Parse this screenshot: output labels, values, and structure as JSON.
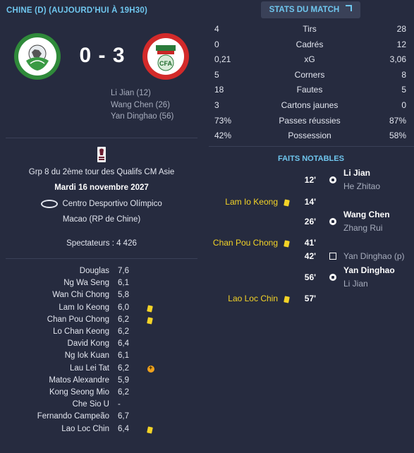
{
  "header": {
    "title": "CHINE (D) (AUJOURD'HUI À 19H30)"
  },
  "score": "0 - 3",
  "scorers": [
    "Li Jian (12)",
    "Wang Chen (26)",
    "Yan Dinghao (56)"
  ],
  "away_crest_text": "CFA",
  "competition": {
    "name": "Grp 8 du 2ème tour des Qualifs CM Asie",
    "date": "Mardi 16 novembre 2027",
    "stadium": "Centro Desportivo Olímpico",
    "city": "Macao (RP de Chine)",
    "attendance": "Spectateurs : 4 426"
  },
  "ratings": [
    {
      "name": "Douglas",
      "rating": "7,6",
      "icon": ""
    },
    {
      "name": "Ng Wa Seng",
      "rating": "6,1",
      "icon": ""
    },
    {
      "name": "Wan Chi Chong",
      "rating": "5,8",
      "icon": ""
    },
    {
      "name": "Lam Io Keong",
      "rating": "6,0",
      "icon": "yellow-card"
    },
    {
      "name": "Chan Pou Chong",
      "rating": "6,2",
      "icon": "yellow-card"
    },
    {
      "name": "Lo Chan Keong",
      "rating": "6,2",
      "icon": ""
    },
    {
      "name": "David Kong",
      "rating": "6,4",
      "icon": ""
    },
    {
      "name": "Ng Iok Kuan",
      "rating": "6,1",
      "icon": ""
    },
    {
      "name": "Lau Lei Tat",
      "rating": "6,2",
      "icon": "substitution"
    },
    {
      "name": "Matos Alexandre",
      "rating": "5,9",
      "icon": ""
    },
    {
      "name": "Kong Seong Mio",
      "rating": "6,2",
      "icon": ""
    },
    {
      "name": "Che Sio U",
      "rating": "-",
      "icon": ""
    },
    {
      "name": "Fernando Campeão",
      "rating": "6,7",
      "icon": ""
    },
    {
      "name": "Lao Loc Chin",
      "rating": "6,4",
      "icon": "yellow-card"
    }
  ],
  "stats_button": "STATS DU MATCH",
  "stats": [
    {
      "home": "4",
      "label": "Tirs",
      "away": "28"
    },
    {
      "home": "0",
      "label": "Cadrés",
      "away": "12"
    },
    {
      "home": "0,21",
      "label": "xG",
      "away": "3,06"
    },
    {
      "home": "5",
      "label": "Corners",
      "away": "8"
    },
    {
      "home": "18",
      "label": "Fautes",
      "away": "5"
    },
    {
      "home": "3",
      "label": "Cartons jaunes",
      "away": "0"
    },
    {
      "home": "73%",
      "label": "Passes réussies",
      "away": "87%"
    },
    {
      "home": "42%",
      "label": "Possession",
      "away": "58%"
    }
  ],
  "faits_title": "FAITS NOTABLES",
  "events": [
    {
      "minute": "12'",
      "side": "away",
      "type": "goal",
      "main": "Li Jian",
      "sub": "He Zhitao"
    },
    {
      "minute": "14'",
      "side": "home",
      "type": "yellow-card",
      "main": "Lam Io Keong",
      "sub": ""
    },
    {
      "minute": "26'",
      "side": "away",
      "type": "goal",
      "main": "Wang Chen",
      "sub": "Zhang Rui"
    },
    {
      "minute": "41'",
      "side": "home",
      "type": "yellow-card",
      "main": "Chan Pou Chong",
      "sub": ""
    },
    {
      "minute": "42'",
      "side": "away",
      "type": "penalty",
      "main": "",
      "sub": "Yan Dinghao (p)"
    },
    {
      "minute": "56'",
      "side": "away",
      "type": "goal",
      "main": "Yan Dinghao",
      "sub": "Li Jian"
    },
    {
      "minute": "57'",
      "side": "home",
      "type": "yellow-card",
      "main": "Lao Loc Chin",
      "sub": ""
    }
  ],
  "colors": {
    "accent": "#6fc6ee",
    "background": "#262b3f",
    "yellow_card": "#f3d327",
    "sub": "#f0a21d"
  }
}
